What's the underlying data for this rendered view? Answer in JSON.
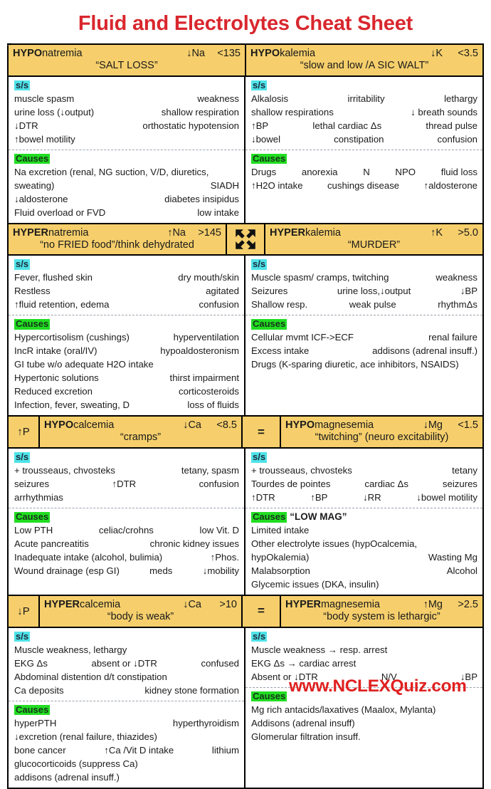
{
  "title": "Fluid and Electrolytes Cheat Sheet",
  "watermark": "www.NCLEXQuiz.com",
  "colors": {
    "title_red": "#D9272E",
    "header_yellow": "#F6CF6C",
    "ss_tag_cyan": "#4FE3E8",
    "causes_tag_green": "#22DD22",
    "watermark_red": "#E02020",
    "border_black": "#000000"
  },
  "labels": {
    "ss": "s/s",
    "causes": "Causes"
  },
  "sections": [
    {
      "left_header": {
        "name_bold": "HYPO",
        "name_rest": "natremia",
        "symbol": "↓Na",
        "value": "<135",
        "mnemonic": "“SALT LOSS”"
      },
      "right_header": {
        "name_bold": "HYPO",
        "name_rest": "kalemia",
        "symbol": "↓K",
        "value": "<3.5",
        "mnemonic": "“slow and low /A SIC WALT”"
      },
      "left": {
        "ss": [
          [
            "muscle spasm",
            "weakness",
            ""
          ],
          [
            "urine loss (↓output)",
            "shallow respiration",
            ""
          ],
          [
            "↓DTR",
            "orthostatic hypotension",
            ""
          ],
          [
            "↑bowel motility",
            "",
            ""
          ]
        ],
        "causes": [
          [
            "Na excretion (renal, NG suction, V/D, diuretics,",
            "",
            ""
          ],
          [
            "sweating)",
            "SIADH",
            ""
          ],
          [
            "↓aldosterone",
            "diabetes insipidus",
            ""
          ],
          [
            "Fluid overload or FVD",
            "low intake",
            ""
          ]
        ]
      },
      "right": {
        "ss": [
          [
            "Alkalosis",
            "irritability",
            "lethargy"
          ],
          [
            "shallow respirations",
            "↓ breath sounds",
            ""
          ],
          [
            "↑BP",
            "lethal cardiac Δs",
            "thread pulse"
          ],
          [
            "↓bowel",
            "constipation",
            "confusion"
          ]
        ],
        "causes": [
          [
            "Drugs",
            "anorexia",
            "N",
            "NPO",
            "fluid loss"
          ],
          [
            "↑H2O intake",
            "cushings disease",
            "↑aldosterone"
          ]
        ]
      }
    },
    {
      "left_header": {
        "name_bold": "HYPER",
        "name_rest": "natremia",
        "symbol": "↑Na",
        "value": ">145",
        "mnemonic": "“no FRIED food”/think dehydrated"
      },
      "middle_icon": "move-four-way-arrow-icon",
      "right_header": {
        "name_bold": "HYPER",
        "name_rest": "kalemia",
        "symbol": "↑K",
        "value": ">5.0",
        "mnemonic": "“MURDER”"
      },
      "left": {
        "ss": [
          [
            "Fever, flushed skin",
            "dry mouth/skin",
            ""
          ],
          [
            "Restless",
            "agitated",
            ""
          ],
          [
            "↑fluid retention, edema",
            "confusion",
            ""
          ]
        ],
        "causes": [
          [
            "Hypercortisolism (cushings)",
            "hyperventilation",
            ""
          ],
          [
            "IncR intake (oral/IV)",
            "hypoaldosteronism",
            ""
          ],
          [
            "GI tube w/o adequate H2O intake",
            "",
            ""
          ],
          [
            "Hypertonic solutions",
            "thirst impairment",
            ""
          ],
          [
            "Reduced excretion",
            "corticosteroids",
            ""
          ],
          [
            "Infection, fever, sweating, D",
            "loss of fluids",
            ""
          ]
        ]
      },
      "right": {
        "ss": [
          [
            "Muscle spasm/ cramps, twitching",
            "weakness",
            ""
          ],
          [
            "Seizures",
            "urine loss,↓output",
            "↓BP"
          ],
          [
            "Shallow resp.",
            "weak pulse",
            "rhythmΔs"
          ]
        ],
        "causes": [
          [
            "Cellular mvmt ICF->ECF",
            "renal failure",
            ""
          ],
          [
            "Excess intake",
            "addisons (adrenal insuff.)",
            ""
          ],
          [
            "Drugs (K-sparing diuretic, ace inhibitors, NSAIDS)",
            "",
            ""
          ]
        ]
      }
    },
    {
      "left_badge": "↑P",
      "left_header": {
        "name_bold": "HYPO",
        "name_rest": "calcemia",
        "symbol": "↓Ca",
        "value": "<8.5",
        "mnemonic": "“cramps”"
      },
      "middle_badge": "=",
      "right_header": {
        "name_bold": "HYPO",
        "name_rest": "magnesemia",
        "symbol": "↓Mg",
        "value": "<1.5",
        "mnemonic": "“twitching” (neuro excitability)"
      },
      "left": {
        "ss": [
          [
            "+ trousseaus, chvosteks",
            "tetany, spasm",
            ""
          ],
          [
            "seizures",
            "↑DTR",
            "confusion"
          ],
          [
            "arrhythmias",
            "",
            ""
          ]
        ],
        "causes": [
          [
            "Low PTH",
            "celiac/crohns",
            "low Vit. D"
          ],
          [
            "Acute pancreatitis",
            "chronic kidney issues",
            ""
          ],
          [
            "Inadequate intake (alcohol, bulimia)",
            "↑Phos.",
            ""
          ],
          [
            "Wound drainage (esp GI)",
            "meds",
            "↓mobility"
          ]
        ]
      },
      "right": {
        "ss": [
          [
            "+ trousseaus, chvosteks",
            "tetany",
            ""
          ],
          [
            "Tourdes de pointes",
            "cardiac Δs",
            "seizures"
          ],
          [
            "↑DTR",
            "↑BP",
            "↓RR",
            "↓bowel motility"
          ]
        ],
        "causes_extra": "“LOW MAG”",
        "causes": [
          [
            "Limited intake",
            "",
            ""
          ],
          [
            "Other electrolyte issues (hypOcalcemia,",
            "",
            ""
          ],
          [
            "hypOkalemia)",
            "Wasting Mg",
            ""
          ],
          [
            "Malabsorption",
            "Alcohol",
            ""
          ],
          [
            "Glycemic issues (DKA, insulin)",
            "",
            ""
          ]
        ]
      }
    },
    {
      "left_badge": "↓P",
      "left_header": {
        "name_bold": "HYPER",
        "name_rest": "calcemia",
        "symbol": "↓Ca",
        "value": ">10",
        "mnemonic": "“body is weak”"
      },
      "middle_badge": "=",
      "right_header": {
        "name_bold": "HYPER",
        "name_rest": "magnesemia",
        "symbol": "↑Mg",
        "value": ">2.5",
        "mnemonic": "“body system is lethargic”"
      },
      "left": {
        "ss": [
          [
            "Muscle weakness, lethargy",
            "",
            ""
          ],
          [
            "EKG Δs",
            "absent or ↓DTR",
            "confused"
          ],
          [
            "Abdominal distention d/t constipation",
            "",
            ""
          ],
          [
            "Ca deposits",
            "kidney stone formation",
            ""
          ]
        ],
        "causes": [
          [
            "hyperPTH",
            "hyperthyroidism",
            ""
          ],
          [
            "↓excretion (renal failure, thiazides)",
            "",
            ""
          ],
          [
            "bone cancer",
            "↑Ca /Vit D intake",
            "lithium"
          ],
          [
            "glucocorticoids (suppress Ca)",
            "",
            ""
          ],
          [
            "addisons (adrenal insuff.)",
            "",
            ""
          ]
        ]
      },
      "right": {
        "ss": [
          [
            "Muscle weakness → resp. arrest",
            "",
            ""
          ],
          [
            "EKG Δs → cardiac arrest",
            "",
            ""
          ],
          [
            "Absent or ↓DTR",
            "N/V",
            "↓BP"
          ]
        ],
        "causes": [
          [
            "Mg rich antacids/laxatives (Maalox, Mylanta)",
            "",
            ""
          ],
          [
            "Addisons (adrenal insuff)",
            "",
            ""
          ],
          [
            "Glomerular filtration insuff.",
            "",
            ""
          ]
        ]
      }
    }
  ]
}
